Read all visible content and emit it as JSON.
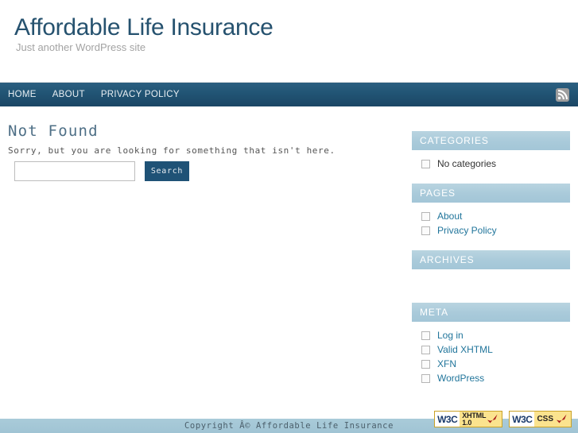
{
  "site": {
    "title": "Affordable Life Insurance",
    "description": "Just another WordPress site",
    "title_color": "#26526f",
    "nav_color": "#215474",
    "widget_header_color": "#a9cada",
    "link_color": "#21759b"
  },
  "nav": {
    "items": [
      {
        "label": "HOME"
      },
      {
        "label": "ABOUT"
      },
      {
        "label": "PRIVACY POLICY"
      }
    ],
    "rss_icon": "rss-feed-icon"
  },
  "content": {
    "heading": "Not Found",
    "message": "Sorry, but you are looking for something that isn't here.",
    "search": {
      "value": "",
      "placeholder": "",
      "submit_label": "Search"
    }
  },
  "sidebar": {
    "widgets": [
      {
        "title": "CATEGORIES",
        "items": [
          {
            "label": "No categories",
            "link": false
          }
        ]
      },
      {
        "title": "PAGES",
        "items": [
          {
            "label": "About",
            "link": true
          },
          {
            "label": "Privacy Policy",
            "link": true
          }
        ]
      },
      {
        "title": "ARCHIVES",
        "items": []
      },
      {
        "title": "META",
        "items": [
          {
            "label": "Log in",
            "link": true
          },
          {
            "label": "Valid XHTML",
            "link": true
          },
          {
            "label": "XFN",
            "link": true
          },
          {
            "label": "WordPress",
            "link": true
          }
        ]
      }
    ]
  },
  "footer": {
    "copyright": "Copyright Â© Affordable Life Insurance",
    "badges": [
      {
        "logo": "W3C",
        "line1": "XHTML",
        "line2": "1.0",
        "type": "two-line"
      },
      {
        "logo": "W3C",
        "line1": "CSS",
        "line2": "",
        "type": "one-line"
      }
    ]
  }
}
